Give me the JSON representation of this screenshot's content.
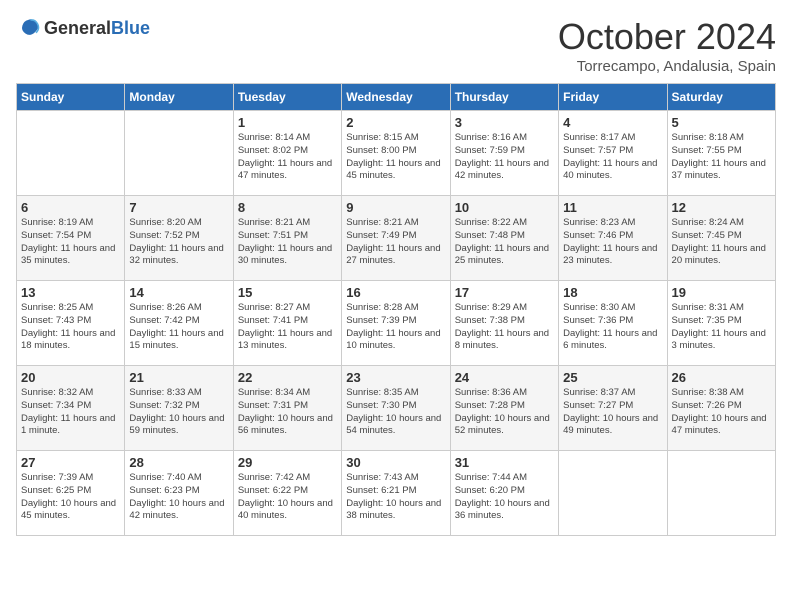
{
  "header": {
    "logo_general": "General",
    "logo_blue": "Blue",
    "month": "October 2024",
    "location": "Torrecampo, Andalusia, Spain"
  },
  "days_of_week": [
    "Sunday",
    "Monday",
    "Tuesday",
    "Wednesday",
    "Thursday",
    "Friday",
    "Saturday"
  ],
  "weeks": [
    [
      {
        "day": "",
        "info": ""
      },
      {
        "day": "",
        "info": ""
      },
      {
        "day": "1",
        "info": "Sunrise: 8:14 AM\nSunset: 8:02 PM\nDaylight: 11 hours and 47 minutes."
      },
      {
        "day": "2",
        "info": "Sunrise: 8:15 AM\nSunset: 8:00 PM\nDaylight: 11 hours and 45 minutes."
      },
      {
        "day": "3",
        "info": "Sunrise: 8:16 AM\nSunset: 7:59 PM\nDaylight: 11 hours and 42 minutes."
      },
      {
        "day": "4",
        "info": "Sunrise: 8:17 AM\nSunset: 7:57 PM\nDaylight: 11 hours and 40 minutes."
      },
      {
        "day": "5",
        "info": "Sunrise: 8:18 AM\nSunset: 7:55 PM\nDaylight: 11 hours and 37 minutes."
      }
    ],
    [
      {
        "day": "6",
        "info": "Sunrise: 8:19 AM\nSunset: 7:54 PM\nDaylight: 11 hours and 35 minutes."
      },
      {
        "day": "7",
        "info": "Sunrise: 8:20 AM\nSunset: 7:52 PM\nDaylight: 11 hours and 32 minutes."
      },
      {
        "day": "8",
        "info": "Sunrise: 8:21 AM\nSunset: 7:51 PM\nDaylight: 11 hours and 30 minutes."
      },
      {
        "day": "9",
        "info": "Sunrise: 8:21 AM\nSunset: 7:49 PM\nDaylight: 11 hours and 27 minutes."
      },
      {
        "day": "10",
        "info": "Sunrise: 8:22 AM\nSunset: 7:48 PM\nDaylight: 11 hours and 25 minutes."
      },
      {
        "day": "11",
        "info": "Sunrise: 8:23 AM\nSunset: 7:46 PM\nDaylight: 11 hours and 23 minutes."
      },
      {
        "day": "12",
        "info": "Sunrise: 8:24 AM\nSunset: 7:45 PM\nDaylight: 11 hours and 20 minutes."
      }
    ],
    [
      {
        "day": "13",
        "info": "Sunrise: 8:25 AM\nSunset: 7:43 PM\nDaylight: 11 hours and 18 minutes."
      },
      {
        "day": "14",
        "info": "Sunrise: 8:26 AM\nSunset: 7:42 PM\nDaylight: 11 hours and 15 minutes."
      },
      {
        "day": "15",
        "info": "Sunrise: 8:27 AM\nSunset: 7:41 PM\nDaylight: 11 hours and 13 minutes."
      },
      {
        "day": "16",
        "info": "Sunrise: 8:28 AM\nSunset: 7:39 PM\nDaylight: 11 hours and 10 minutes."
      },
      {
        "day": "17",
        "info": "Sunrise: 8:29 AM\nSunset: 7:38 PM\nDaylight: 11 hours and 8 minutes."
      },
      {
        "day": "18",
        "info": "Sunrise: 8:30 AM\nSunset: 7:36 PM\nDaylight: 11 hours and 6 minutes."
      },
      {
        "day": "19",
        "info": "Sunrise: 8:31 AM\nSunset: 7:35 PM\nDaylight: 11 hours and 3 minutes."
      }
    ],
    [
      {
        "day": "20",
        "info": "Sunrise: 8:32 AM\nSunset: 7:34 PM\nDaylight: 11 hours and 1 minute."
      },
      {
        "day": "21",
        "info": "Sunrise: 8:33 AM\nSunset: 7:32 PM\nDaylight: 10 hours and 59 minutes."
      },
      {
        "day": "22",
        "info": "Sunrise: 8:34 AM\nSunset: 7:31 PM\nDaylight: 10 hours and 56 minutes."
      },
      {
        "day": "23",
        "info": "Sunrise: 8:35 AM\nSunset: 7:30 PM\nDaylight: 10 hours and 54 minutes."
      },
      {
        "day": "24",
        "info": "Sunrise: 8:36 AM\nSunset: 7:28 PM\nDaylight: 10 hours and 52 minutes."
      },
      {
        "day": "25",
        "info": "Sunrise: 8:37 AM\nSunset: 7:27 PM\nDaylight: 10 hours and 49 minutes."
      },
      {
        "day": "26",
        "info": "Sunrise: 8:38 AM\nSunset: 7:26 PM\nDaylight: 10 hours and 47 minutes."
      }
    ],
    [
      {
        "day": "27",
        "info": "Sunrise: 7:39 AM\nSunset: 6:25 PM\nDaylight: 10 hours and 45 minutes."
      },
      {
        "day": "28",
        "info": "Sunrise: 7:40 AM\nSunset: 6:23 PM\nDaylight: 10 hours and 42 minutes."
      },
      {
        "day": "29",
        "info": "Sunrise: 7:42 AM\nSunset: 6:22 PM\nDaylight: 10 hours and 40 minutes."
      },
      {
        "day": "30",
        "info": "Sunrise: 7:43 AM\nSunset: 6:21 PM\nDaylight: 10 hours and 38 minutes."
      },
      {
        "day": "31",
        "info": "Sunrise: 7:44 AM\nSunset: 6:20 PM\nDaylight: 10 hours and 36 minutes."
      },
      {
        "day": "",
        "info": ""
      },
      {
        "day": "",
        "info": ""
      }
    ]
  ]
}
